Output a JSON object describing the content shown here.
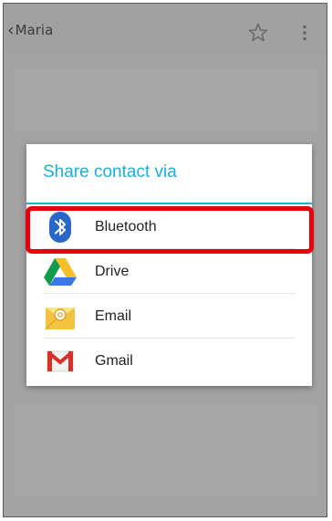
{
  "header": {
    "back_chevron": "‹",
    "title": "Maria",
    "star_icon": "star-outline-icon",
    "menu_icon": "overflow-menu-icon"
  },
  "dialog": {
    "title": "Share contact via",
    "items": [
      {
        "label": "Bluetooth",
        "icon": "bluetooth-icon",
        "highlighted": true
      },
      {
        "label": "Drive",
        "icon": "drive-icon",
        "highlighted": false
      },
      {
        "label": "Email",
        "icon": "email-icon",
        "highlighted": false
      },
      {
        "label": "Gmail",
        "icon": "gmail-icon",
        "highlighted": false
      }
    ]
  },
  "colors": {
    "dim_background": "#a3a3a3",
    "dialog_title": "#1ab0dc",
    "highlight": "#e8000b",
    "bluetooth": "#2a67c9"
  }
}
